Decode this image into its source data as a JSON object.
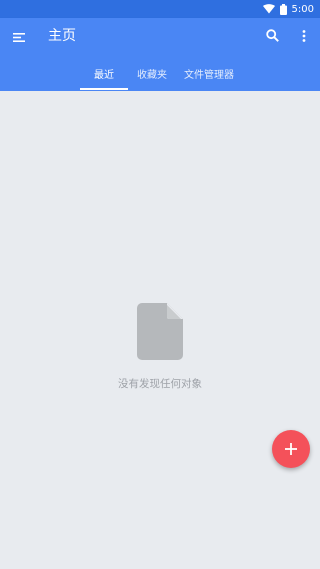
{
  "status_bar": {
    "time": "5:00",
    "icons": [
      "wifi-icon",
      "battery-icon"
    ]
  },
  "toolbar": {
    "title": "主页",
    "icons": [
      "menu-icon",
      "search-icon",
      "more-vert-icon"
    ]
  },
  "tabs": [
    {
      "label": "最近",
      "active": true
    },
    {
      "label": "收藏夹",
      "active": false
    },
    {
      "label": "文件管理器",
      "active": false
    }
  ],
  "empty_state": {
    "icon": "file-icon",
    "message": "没有发现任何对象"
  },
  "fab": {
    "icon": "plus-icon"
  },
  "colors": {
    "status_bar": "#2f6fe0",
    "app_bar": "#4a86f4",
    "background": "#e8ebef",
    "empty_icon": "#b5b8bb",
    "fab": "#f4515a"
  }
}
